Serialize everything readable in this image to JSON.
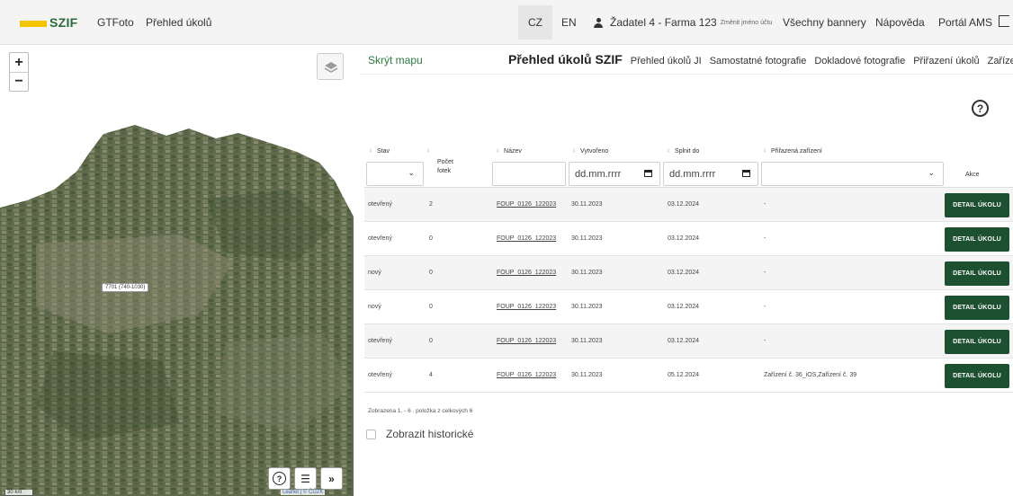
{
  "topbar": {
    "logo": "SZIF",
    "nav": [
      "GTFoto",
      "Přehled úkolů"
    ],
    "lang_cz": "CZ",
    "lang_en": "EN",
    "user": "Žadatel 4 - Farma 123",
    "change_account": "Změnit jméno účtu",
    "banners": "Všechny bannery",
    "help": "Nápověda",
    "portal": "Portál AMS"
  },
  "map": {
    "zoom_in": "+",
    "zoom_out": "−",
    "parcel_label": "7701 (740-1030)",
    "scale": "30 km",
    "attribution": "Leaflet | © ČÚZK",
    "help_glyph": "?",
    "list_glyph": "☰",
    "expand_glyph": "»"
  },
  "panel": {
    "hide_map": "Skrýt mapu",
    "tabs": [
      "Přehled úkolů SZIF",
      "Přehled úkolů JI",
      "Samostatné fotografie",
      "Dokladové fotografie",
      "Přiřazení úkolů",
      "Zařízení"
    ],
    "active_tab": 0,
    "help_glyph": "?"
  },
  "table": {
    "columns": {
      "stav": "Stav",
      "pocet": "Počet fotek",
      "nazev": "Název",
      "vytvoreno": "Vytvořeno",
      "splnit": "Splnit do",
      "zarizeni": "Přiřazená zařízení",
      "akce": "Akce"
    },
    "date_placeholder": "dd.mm.rrrr",
    "rows": [
      {
        "stav": "otevřený",
        "pocet": "2",
        "nazev": "FOUP_0126_122023",
        "vytvoreno": "30.11.2023",
        "splnit": "03.12.2024",
        "zarizeni": "-",
        "action": "DETAIL ÚKOLU"
      },
      {
        "stav": "otevřený",
        "pocet": "0",
        "nazev": "FOUP_0126_122023",
        "vytvoreno": "30.11.2023",
        "splnit": "03.12.2024",
        "zarizeni": "-",
        "action": "DETAIL ÚKOLU"
      },
      {
        "stav": "nový",
        "pocet": "0",
        "nazev": "FOUP_0126_122023",
        "vytvoreno": "30.11.2023",
        "splnit": "03.12.2024",
        "zarizeni": "-",
        "action": "DETAIL ÚKOLU"
      },
      {
        "stav": "nový",
        "pocet": "0",
        "nazev": "FOUP_0126_122023",
        "vytvoreno": "30.11.2023",
        "splnit": "03.12.2024",
        "zarizeni": "-",
        "action": "DETAIL ÚKOLU"
      },
      {
        "stav": "otevřený",
        "pocet": "0",
        "nazev": "FOUP_0126_122023",
        "vytvoreno": "30.11.2023",
        "splnit": "03.12.2024",
        "zarizeni": "-",
        "action": "DETAIL ÚKOLU"
      },
      {
        "stav": "otevřený",
        "pocet": "4",
        "nazev": "FOUP_0126_122023",
        "vytvoreno": "30.11.2023",
        "splnit": "05.12.2024",
        "zarizeni": "Zařízení č. 36_iOS,Zařízení č. 39",
        "action": "DETAIL ÚKOLU"
      }
    ],
    "summary": "Zobrazena 1. - 6 . položka z celkových 6",
    "show_historical": "Zobrazit historické"
  },
  "colors": {
    "brand_green": "#1d4f31",
    "link_green": "#2b7a3b",
    "logo_yellow": "#f2c500"
  }
}
